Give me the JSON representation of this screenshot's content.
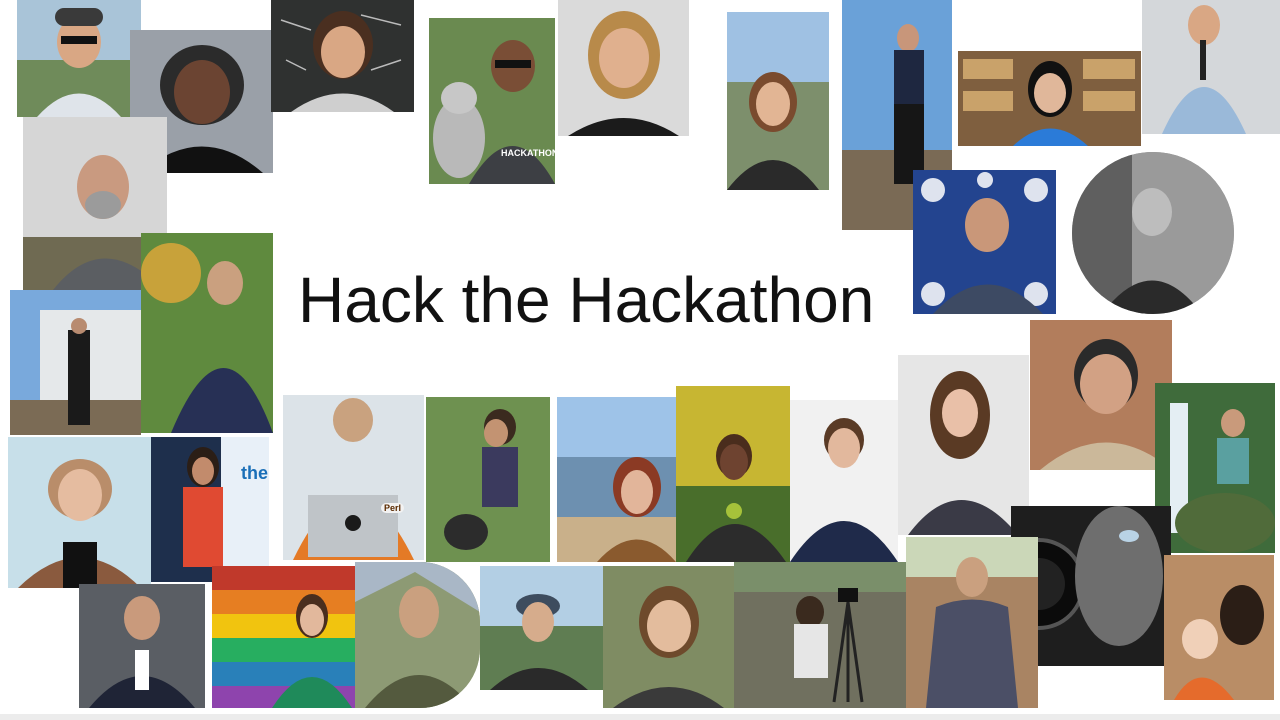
{
  "slide": {
    "title": "Hack the Hackathon",
    "background": "#ffffff",
    "title_color": "#111111"
  },
  "photos": {
    "shirt_text": "HACKATHON",
    "sticker_text": "Perl",
    "sign_text": "the"
  },
  "palette": {
    "skin": "#d9a784",
    "rainbow": [
      "#c0392b",
      "#e67e22",
      "#f1c40f",
      "#27ae60",
      "#2980b9",
      "#8e44ad"
    ]
  }
}
